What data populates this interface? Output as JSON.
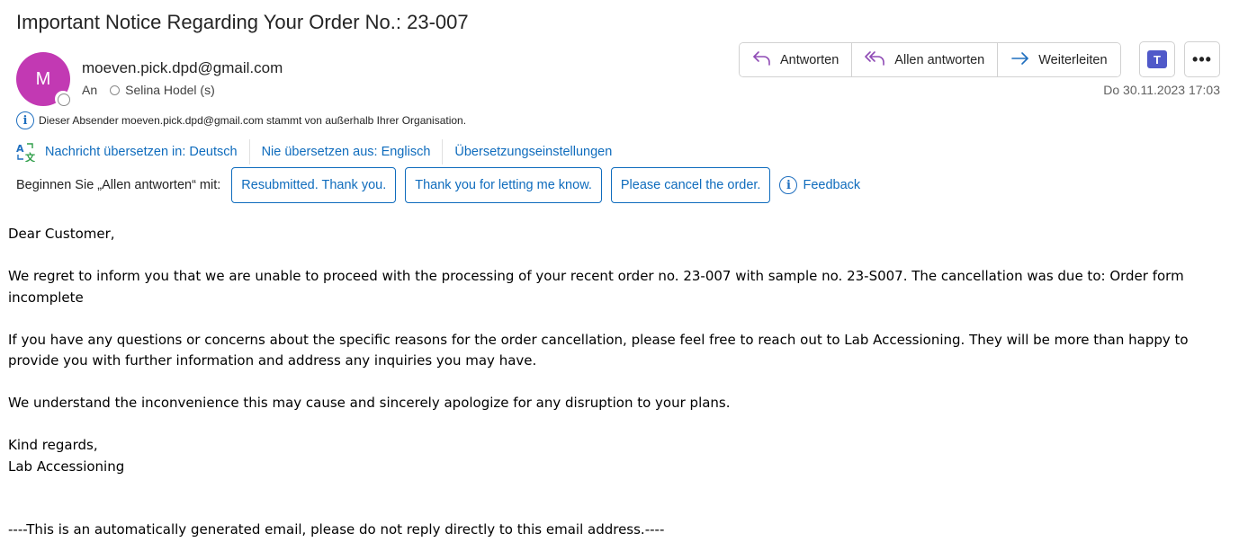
{
  "header": {
    "subject": "Important Notice Regarding Your Order No.:  23-007",
    "avatar_initial": "M",
    "avatar_color": "#c239b3",
    "sender": "moeven.pick.dpd@gmail.com",
    "to_label": "An",
    "recipient": "Selina Hodel (s)",
    "datetime": "Do 30.11.2023 17:03"
  },
  "actions": {
    "reply": "Antworten",
    "reply_all": "Allen antworten",
    "forward": "Weiterleiten"
  },
  "external_notice": "Dieser Absender moeven.pick.dpd@gmail.com stammt von außerhalb Ihrer Organisation.",
  "translate": {
    "translate_to": "Nachricht übersetzen in: Deutsch",
    "never_translate": "Nie übersetzen aus: Englisch",
    "settings": "Übersetzungseinstellungen"
  },
  "quick_reply": {
    "label": "Beginnen Sie „Allen antworten“ mit:",
    "suggestions": [
      "Resubmitted. Thank you.",
      "Thank you for letting me know.",
      "Please cancel the order."
    ],
    "feedback": "Feedback"
  },
  "body": {
    "greeting": "Dear Customer,",
    "p1": "We regret to inform you that we are unable to proceed with the processing of your recent order no. 23-007  with sample no. 23-S007. The cancellation was due to: Order form incomplete",
    "p2": "If you have any questions or concerns about the specific reasons for the order cancellation, please feel free to reach out to Lab Accessioning. They will be more than happy to provide you with further information and address any inquiries you may have.",
    "p3": "We understand the inconvenience this may cause and sincerely apologize for any disruption to your plans.",
    "closing": "Kind regards,",
    "signature": "Lab Accessioning",
    "footer": "----This is an automatically generated email, please do not reply directly to this email address.----"
  },
  "colors": {
    "accent": "#0f6cbd",
    "reply_icon": "#8f4bb5",
    "teams": "#5059c9"
  }
}
